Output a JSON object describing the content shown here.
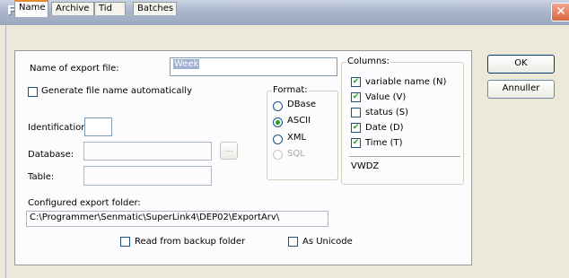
{
  "window": {
    "title": "Filter",
    "close_glyph": "✕"
  },
  "tabs": [
    {
      "label": "Name",
      "active": true
    },
    {
      "label": "Archive",
      "active": false
    },
    {
      "label": "Tid",
      "active": false
    },
    {
      "label": "Batches",
      "active": false
    }
  ],
  "form": {
    "export_file_label": "Name of export file:",
    "export_file_value": "Week",
    "generate_label": "Generate file name automatically",
    "identification_label": "Identification:",
    "database_label": "Database:",
    "browse_label": "...",
    "table_label": "Table:",
    "configured_folder_label": "Configured export folder:",
    "configured_folder_value": "C:\\Programmer\\Senmatic\\SuperLink4\\DEP02\\ExportArv\\",
    "backup_label": "Read from backup folder",
    "unicode_label": "As Unicode"
  },
  "format": {
    "title": "Format:",
    "options": [
      {
        "label": "DBase",
        "selected": false,
        "enabled": true
      },
      {
        "label": "ASCII",
        "selected": true,
        "enabled": true
      },
      {
        "label": "XML",
        "selected": false,
        "enabled": true
      },
      {
        "label": "SQL",
        "selected": false,
        "enabled": false
      }
    ]
  },
  "columns": {
    "title": "Columns:",
    "items": [
      {
        "label": "variable name (N)",
        "checked": true
      },
      {
        "label": "Value (V)",
        "checked": true
      },
      {
        "label": "status (S)",
        "checked": false
      },
      {
        "label": "Date (D)",
        "checked": true
      },
      {
        "label": "Time (T)",
        "checked": true
      }
    ],
    "code": "VWDZ"
  },
  "buttons": {
    "ok": "OK",
    "cancel": "Annuller"
  }
}
